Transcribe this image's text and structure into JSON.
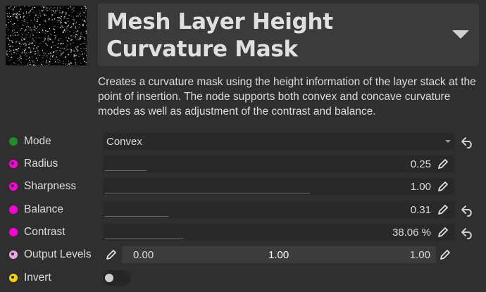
{
  "node": {
    "title": "Mesh Layer Height Curvature Mask",
    "description": "Creates a curvature mask using the height information of the layer stack at the point of insertion. The node supports both convex and concave curvature modes as well as adjustment of the contrast and balance.",
    "thumbnail_icon": "noise-preview-thumbnail",
    "collapse_icon": "triangle-down-icon"
  },
  "params": {
    "mode": {
      "label": "Mode",
      "value": "Convex",
      "port_color": "#1b8f2a"
    },
    "radius": {
      "label": "Radius",
      "value": "0.25",
      "level": 0.25,
      "port_color": "#ff00d6"
    },
    "sharpness": {
      "label": "Sharpness",
      "value": "1.00",
      "level": 1.0,
      "port_color": "#ff00d6"
    },
    "balance": {
      "label": "Balance",
      "value": "0.31",
      "level": 0.31,
      "port_color": "#ff00d6"
    },
    "contrast": {
      "label": "Contrast",
      "value": "38.06 %",
      "level": 0.3806,
      "port_color": "#ff00d6"
    },
    "output_levels": {
      "label": "Output Levels",
      "low": "0.00",
      "mid": "1.00",
      "high": "1.00",
      "port_color": "#e6a6e0"
    },
    "invert": {
      "label": "Invert",
      "on": false,
      "port_color": "#f2d400"
    }
  }
}
